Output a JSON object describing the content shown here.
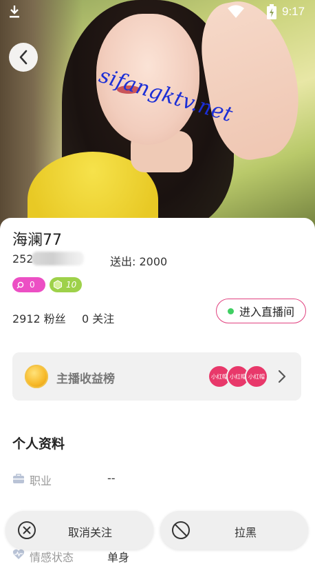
{
  "status_bar": {
    "time": "9:17"
  },
  "hero": {
    "watermark": "sifangktv.net"
  },
  "profile": {
    "name": "海澜77",
    "uid_prefix": "252",
    "sent": "送出: 2000",
    "badge_pink_value": "0",
    "badge_green_value": "10",
    "fans": "2912 粉丝",
    "follows": "0 关注",
    "live_button": "进入直播间"
  },
  "earnings": {
    "title": "主播收益榜",
    "avatars": [
      "小红帽",
      "小红帽",
      "小红帽"
    ]
  },
  "info": {
    "title": "个人资料",
    "rows": [
      {
        "label": "职业",
        "value": "--"
      },
      {
        "label": "情感状态",
        "value": "单身"
      }
    ]
  },
  "actions": {
    "unfollow": "取消关注",
    "block": "拉黑"
  },
  "colors": {
    "accent_pink": "#e0407e",
    "badge_pink": "#ec4fc4",
    "badge_green": "#9ed14a",
    "live_dot": "#3fcf62",
    "avatar_red": "#e8386a"
  }
}
